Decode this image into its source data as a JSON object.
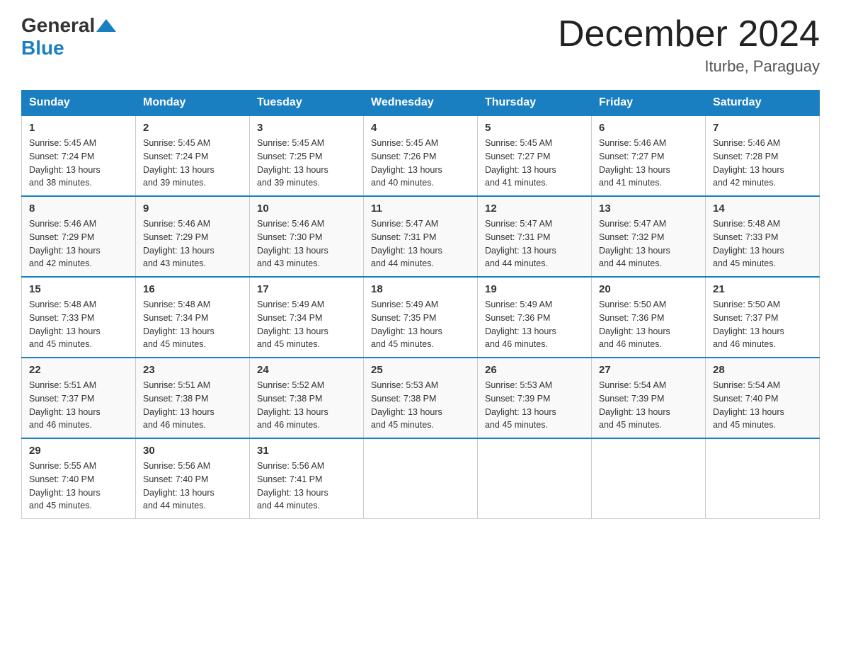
{
  "header": {
    "logo_general": "General",
    "logo_blue": "Blue",
    "month_title": "December 2024",
    "location": "Iturbe, Paraguay"
  },
  "weekdays": [
    "Sunday",
    "Monday",
    "Tuesday",
    "Wednesday",
    "Thursday",
    "Friday",
    "Saturday"
  ],
  "weeks": [
    [
      {
        "day": "1",
        "sunrise": "5:45 AM",
        "sunset": "7:24 PM",
        "daylight": "13 hours and 38 minutes."
      },
      {
        "day": "2",
        "sunrise": "5:45 AM",
        "sunset": "7:24 PM",
        "daylight": "13 hours and 39 minutes."
      },
      {
        "day": "3",
        "sunrise": "5:45 AM",
        "sunset": "7:25 PM",
        "daylight": "13 hours and 39 minutes."
      },
      {
        "day": "4",
        "sunrise": "5:45 AM",
        "sunset": "7:26 PM",
        "daylight": "13 hours and 40 minutes."
      },
      {
        "day": "5",
        "sunrise": "5:45 AM",
        "sunset": "7:27 PM",
        "daylight": "13 hours and 41 minutes."
      },
      {
        "day": "6",
        "sunrise": "5:46 AM",
        "sunset": "7:27 PM",
        "daylight": "13 hours and 41 minutes."
      },
      {
        "day": "7",
        "sunrise": "5:46 AM",
        "sunset": "7:28 PM",
        "daylight": "13 hours and 42 minutes."
      }
    ],
    [
      {
        "day": "8",
        "sunrise": "5:46 AM",
        "sunset": "7:29 PM",
        "daylight": "13 hours and 42 minutes."
      },
      {
        "day": "9",
        "sunrise": "5:46 AM",
        "sunset": "7:29 PM",
        "daylight": "13 hours and 43 minutes."
      },
      {
        "day": "10",
        "sunrise": "5:46 AM",
        "sunset": "7:30 PM",
        "daylight": "13 hours and 43 minutes."
      },
      {
        "day": "11",
        "sunrise": "5:47 AM",
        "sunset": "7:31 PM",
        "daylight": "13 hours and 44 minutes."
      },
      {
        "day": "12",
        "sunrise": "5:47 AM",
        "sunset": "7:31 PM",
        "daylight": "13 hours and 44 minutes."
      },
      {
        "day": "13",
        "sunrise": "5:47 AM",
        "sunset": "7:32 PM",
        "daylight": "13 hours and 44 minutes."
      },
      {
        "day": "14",
        "sunrise": "5:48 AM",
        "sunset": "7:33 PM",
        "daylight": "13 hours and 45 minutes."
      }
    ],
    [
      {
        "day": "15",
        "sunrise": "5:48 AM",
        "sunset": "7:33 PM",
        "daylight": "13 hours and 45 minutes."
      },
      {
        "day": "16",
        "sunrise": "5:48 AM",
        "sunset": "7:34 PM",
        "daylight": "13 hours and 45 minutes."
      },
      {
        "day": "17",
        "sunrise": "5:49 AM",
        "sunset": "7:34 PM",
        "daylight": "13 hours and 45 minutes."
      },
      {
        "day": "18",
        "sunrise": "5:49 AM",
        "sunset": "7:35 PM",
        "daylight": "13 hours and 45 minutes."
      },
      {
        "day": "19",
        "sunrise": "5:49 AM",
        "sunset": "7:36 PM",
        "daylight": "13 hours and 46 minutes."
      },
      {
        "day": "20",
        "sunrise": "5:50 AM",
        "sunset": "7:36 PM",
        "daylight": "13 hours and 46 minutes."
      },
      {
        "day": "21",
        "sunrise": "5:50 AM",
        "sunset": "7:37 PM",
        "daylight": "13 hours and 46 minutes."
      }
    ],
    [
      {
        "day": "22",
        "sunrise": "5:51 AM",
        "sunset": "7:37 PM",
        "daylight": "13 hours and 46 minutes."
      },
      {
        "day": "23",
        "sunrise": "5:51 AM",
        "sunset": "7:38 PM",
        "daylight": "13 hours and 46 minutes."
      },
      {
        "day": "24",
        "sunrise": "5:52 AM",
        "sunset": "7:38 PM",
        "daylight": "13 hours and 46 minutes."
      },
      {
        "day": "25",
        "sunrise": "5:53 AM",
        "sunset": "7:38 PM",
        "daylight": "13 hours and 45 minutes."
      },
      {
        "day": "26",
        "sunrise": "5:53 AM",
        "sunset": "7:39 PM",
        "daylight": "13 hours and 45 minutes."
      },
      {
        "day": "27",
        "sunrise": "5:54 AM",
        "sunset": "7:39 PM",
        "daylight": "13 hours and 45 minutes."
      },
      {
        "day": "28",
        "sunrise": "5:54 AM",
        "sunset": "7:40 PM",
        "daylight": "13 hours and 45 minutes."
      }
    ],
    [
      {
        "day": "29",
        "sunrise": "5:55 AM",
        "sunset": "7:40 PM",
        "daylight": "13 hours and 45 minutes."
      },
      {
        "day": "30",
        "sunrise": "5:56 AM",
        "sunset": "7:40 PM",
        "daylight": "13 hours and 44 minutes."
      },
      {
        "day": "31",
        "sunrise": "5:56 AM",
        "sunset": "7:41 PM",
        "daylight": "13 hours and 44 minutes."
      },
      null,
      null,
      null,
      null
    ]
  ],
  "labels": {
    "sunrise": "Sunrise:",
    "sunset": "Sunset:",
    "daylight": "Daylight:"
  }
}
